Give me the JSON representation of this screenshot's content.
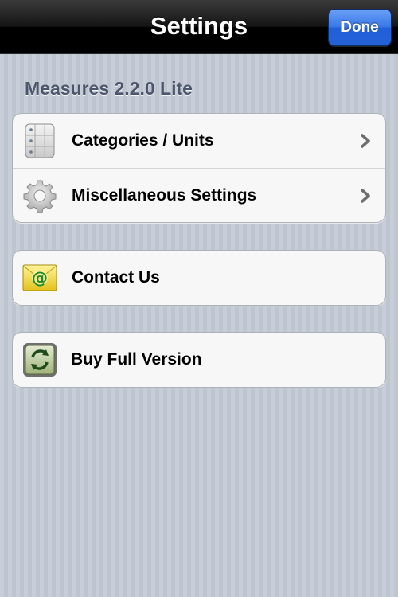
{
  "navbar": {
    "title": "Settings",
    "done_label": "Done"
  },
  "section": {
    "header": "Measures 2.2.0 Lite"
  },
  "groups": [
    {
      "rows": [
        {
          "label": "Categories / Units",
          "icon": "list-icon",
          "chevron": true
        },
        {
          "label": "Miscellaneous Settings",
          "icon": "gear-icon",
          "chevron": true
        }
      ]
    },
    {
      "rows": [
        {
          "label": "Contact Us",
          "icon": "email-icon",
          "chevron": false
        }
      ]
    },
    {
      "rows": [
        {
          "label": "Buy Full Version",
          "icon": "refresh-icon",
          "chevron": false
        }
      ]
    }
  ],
  "colors": {
    "navbar_bg": "#000000",
    "done_button": "#2462d6",
    "section_header": "#4c566c",
    "cell_bg": "#f7f7f7",
    "background": "#c5ccd6"
  }
}
